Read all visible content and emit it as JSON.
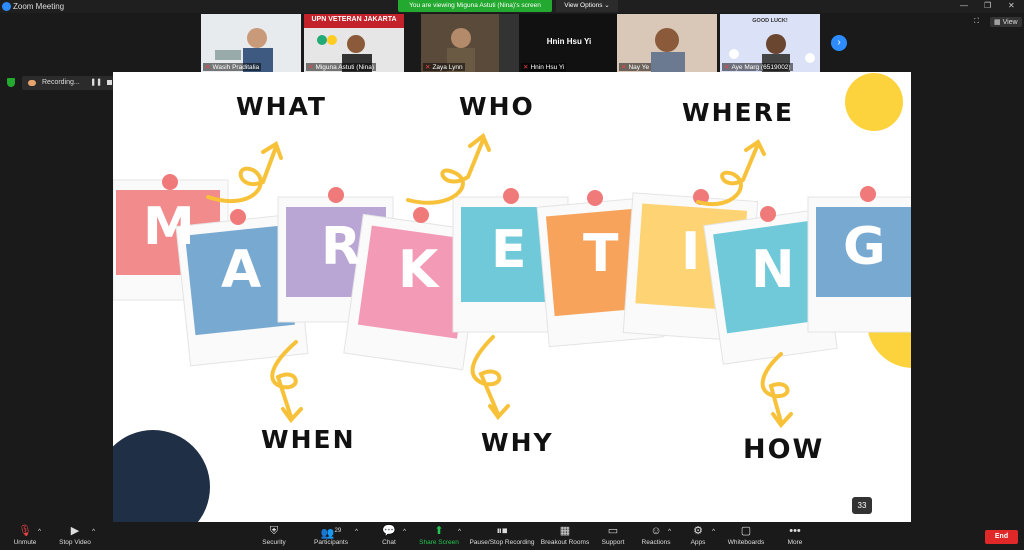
{
  "window": {
    "title": "Zoom Meeting"
  },
  "banner": {
    "viewing": "You are viewing Miguna Astuti (Nina)'s screen",
    "view_options": "View Options"
  },
  "top_right": {
    "view_label": "View"
  },
  "participants_strip": [
    {
      "name": "Wasih Praditalia"
    },
    {
      "name": "Miguna Astuti (Nina)",
      "sign_text": "UPN VETERAN JAKARTA"
    },
    {
      "name": "Zaya Lynn"
    },
    {
      "name": "Hnin Hsu Yi",
      "display_name": "Hnin Hsu Yi"
    },
    {
      "name": "Nay Ye"
    },
    {
      "name": "Aye Marg (6519002)",
      "sign_text": "GOOD LUCK!"
    }
  ],
  "recording": {
    "label": "Recording..."
  },
  "slide": {
    "words": [
      "WHAT",
      "WHO",
      "WHERE",
      "WHEN",
      "WHY",
      "HOW"
    ],
    "letters": [
      "M",
      "A",
      "R",
      "K",
      "E",
      "T",
      "I",
      "N",
      "G"
    ],
    "page_number": "33"
  },
  "toolbar": {
    "unmute": "Unmute",
    "stop_video": "Stop Video",
    "security": "Security",
    "participants": "Participants",
    "participant_count": "29",
    "chat": "Chat",
    "share_screen": "Share Screen",
    "pause_recording": "Pause/Stop Recording",
    "breakout_rooms": "Breakout Rooms",
    "support": "Support",
    "reactions": "Reactions",
    "apps": "Apps",
    "whiteboards": "Whiteboards",
    "more": "More",
    "end": "End"
  },
  "colors": {
    "accent_green": "#23a92f",
    "end_red": "#e02828",
    "zoom_blue": "#2d8cff",
    "slide_yellow": "#fdd33d",
    "slide_navy": "#1f2f45"
  }
}
